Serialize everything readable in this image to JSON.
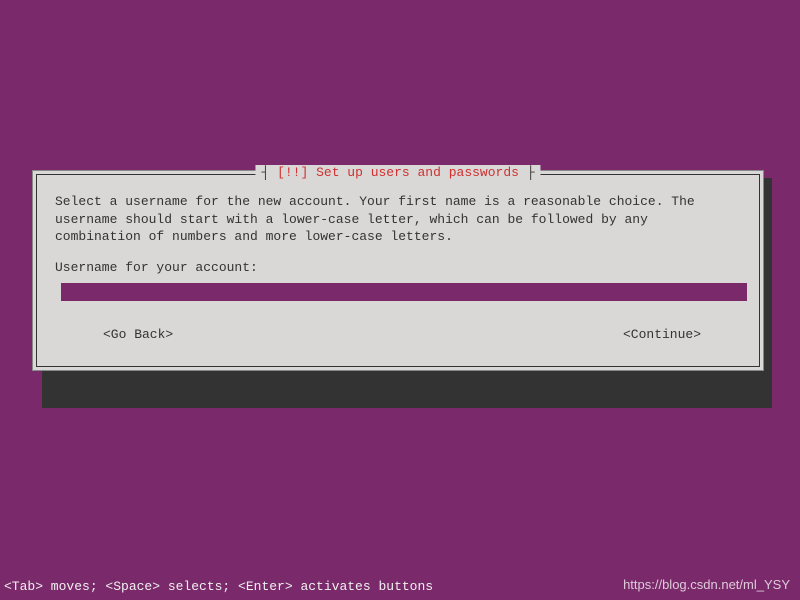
{
  "dialog": {
    "title_prefix": "┤ ",
    "title_tag": "[!!]",
    "title_text": " Set up users and passwords",
    "title_suffix": " ├",
    "description": "Select a username for the new account. Your first name is a reasonable choice. The username should start with a lower-case letter, which can be followed by any combination of numbers and more lower-case letters.",
    "prompt": "Username for your account:",
    "input_value": "",
    "go_back_label": "<Go Back>",
    "continue_label": "<Continue>"
  },
  "footer": {
    "help_text": "<Tab> moves; <Space> selects; <Enter> activates buttons"
  },
  "watermark": "https://blog.csdn.net/ml_YSY"
}
